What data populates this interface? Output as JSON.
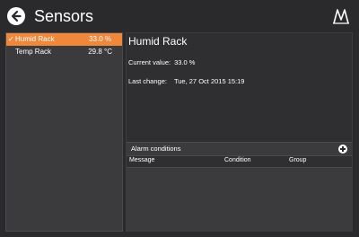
{
  "header": {
    "title": "Sensors",
    "back_icon": "arrow-left-circle-icon",
    "logo_icon": "brand-logo-icon"
  },
  "sensors": [
    {
      "name": "Humid Rack",
      "value": "33.0 %",
      "selected": true
    },
    {
      "name": "Temp Rack",
      "value": "29.8 °C",
      "selected": false
    }
  ],
  "detail": {
    "title": "Humid Rack",
    "current_value_label": "Current value:",
    "current_value": "33.0 %",
    "last_change_label": "Last change:",
    "last_change": "Tue, 27 Oct 2015 15:19"
  },
  "alarms": {
    "title": "Alarm conditions",
    "add_icon": "plus-circle-icon",
    "columns": [
      "Message",
      "Condition",
      "Group"
    ],
    "rows": []
  },
  "colors": {
    "accent": "#f0883c",
    "background": "#2a2a2d",
    "panel": "#3b3b3e"
  }
}
